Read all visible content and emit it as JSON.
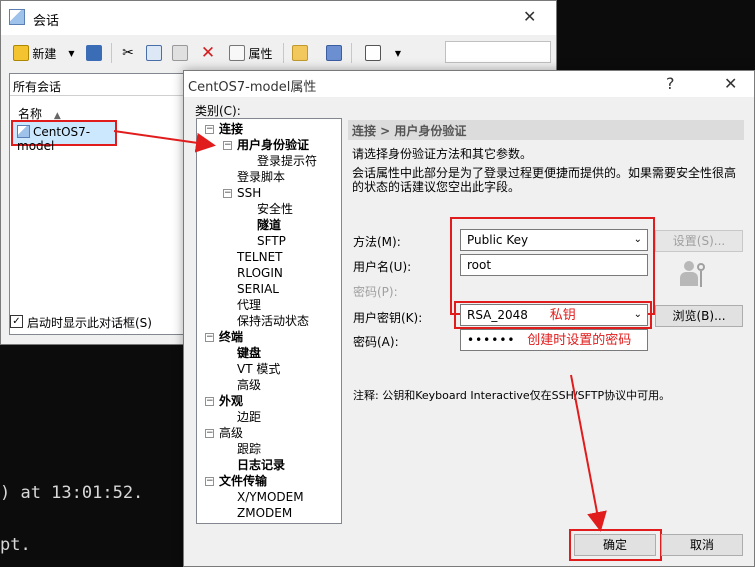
{
  "terminal": {
    "line1": ") at 13:01:52.",
    "line2": "pt."
  },
  "sessions_window": {
    "title": "会话",
    "toolbar": {
      "new_label": "新建",
      "properties_label": "属性"
    },
    "panel_header": "所有会话",
    "column_name": "名称",
    "session_item": "CentOS7-model",
    "show_on_startup_label": "启动时显示此对话框(S)",
    "search_placeholder": ""
  },
  "properties_dialog": {
    "title": "CentOS7-model属性",
    "category_label": "类别(C):",
    "tree": [
      {
        "label": "连接",
        "level": 0,
        "bold": true,
        "expander": "−"
      },
      {
        "label": "用户身份验证",
        "level": 1,
        "bold": true,
        "expander": "−"
      },
      {
        "label": "登录提示符",
        "level": 2,
        "bold": false
      },
      {
        "label": "登录脚本",
        "level": 1,
        "bold": false
      },
      {
        "label": "SSH",
        "level": 1,
        "bold": false,
        "expander": "−"
      },
      {
        "label": "安全性",
        "level": 2,
        "bold": false
      },
      {
        "label": "隧道",
        "level": 2,
        "bold": true
      },
      {
        "label": "SFTP",
        "level": 2,
        "bold": false
      },
      {
        "label": "TELNET",
        "level": 1,
        "bold": false
      },
      {
        "label": "RLOGIN",
        "level": 1,
        "bold": false
      },
      {
        "label": "SERIAL",
        "level": 1,
        "bold": false
      },
      {
        "label": "代理",
        "level": 1,
        "bold": false
      },
      {
        "label": "保持活动状态",
        "level": 1,
        "bold": false
      },
      {
        "label": "终端",
        "level": 0,
        "bold": true,
        "expander": "−"
      },
      {
        "label": "键盘",
        "level": 1,
        "bold": true
      },
      {
        "label": "VT 模式",
        "level": 1,
        "bold": false
      },
      {
        "label": "高级",
        "level": 1,
        "bold": false
      },
      {
        "label": "外观",
        "level": 0,
        "bold": true,
        "expander": "−"
      },
      {
        "label": "边距",
        "level": 1,
        "bold": false
      },
      {
        "label": "高级",
        "level": 0,
        "bold": false,
        "expander": "−"
      },
      {
        "label": "跟踪",
        "level": 1,
        "bold": false
      },
      {
        "label": "日志记录",
        "level": 1,
        "bold": true
      },
      {
        "label": "文件传输",
        "level": 0,
        "bold": true,
        "expander": "−"
      },
      {
        "label": "X/YMODEM",
        "level": 1,
        "bold": false
      },
      {
        "label": "ZMODEM",
        "level": 1,
        "bold": false
      }
    ],
    "breadcrumb": "连接 > 用户身份验证",
    "description_1": "请选择身份验证方法和其它参数。",
    "description_2": "会话属性中此部分是为了登录过程更便捷而提供的。如果需要安全性很高",
    "description_3": "的状态的话建议您空出此字段。",
    "method_label": "方法(M):",
    "method_value": "Public Key",
    "settings_button": "设置(S)...",
    "username_label": "用户名(U):",
    "username_value": "root",
    "password_label_disabled": "密码(P):",
    "user_key_label": "用户密钥(K):",
    "user_key_value": "RSA_2048",
    "user_key_annotation": "私钥",
    "browse_button": "浏览(B)...",
    "passphrase_label": "密码(A):",
    "passphrase_value": "••••••",
    "passphrase_annotation": "创建时设置的密码",
    "note": "注释: 公钥和Keyboard Interactive仅在SSH/SFTP协议中可用。",
    "ok_button": "确定",
    "cancel_button": "取消"
  },
  "colors": {
    "annotation_red": "#e11c1c",
    "selection": "#cce8ff"
  }
}
